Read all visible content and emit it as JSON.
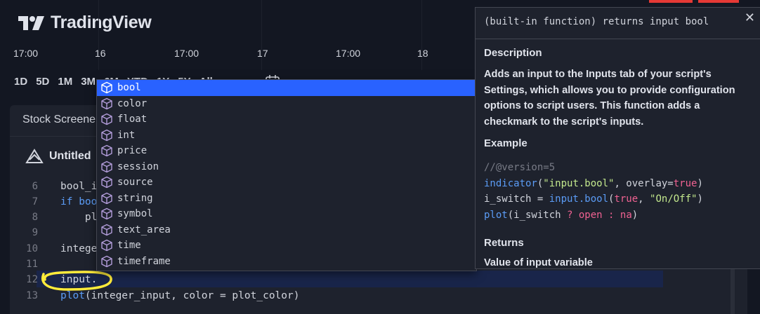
{
  "app": {
    "logo_text": "TradingView"
  },
  "time_axis": [
    "17:00",
    "16",
    "17:00",
    "17",
    "17:00",
    "18"
  ],
  "ranges": [
    "1D",
    "5D",
    "1M",
    "3M",
    "6M",
    "YTD",
    "1Y",
    "5Y",
    "All"
  ],
  "panel": {
    "tab_label": "Stock Screene",
    "script_name": "Untitled"
  },
  "editor": {
    "lines": [
      {
        "num": "6",
        "text": "bool_i"
      },
      {
        "num": "7",
        "text": "if boo"
      },
      {
        "num": "8",
        "text": "    pl"
      },
      {
        "num": "9",
        "text": ""
      },
      {
        "num": "10",
        "text": "intege"
      },
      {
        "num": "11",
        "text": ""
      },
      {
        "num": "12",
        "text": "input."
      },
      {
        "num": "13",
        "text_fn": "plot",
        "text_rest": "(integer_input, color = plot_color)"
      }
    ]
  },
  "autocomplete": {
    "items": [
      "bool",
      "color",
      "float",
      "int",
      "price",
      "session",
      "source",
      "string",
      "symbol",
      "text_area",
      "time",
      "timeframe"
    ],
    "selected_index": 0
  },
  "docs": {
    "signature": "(built-in function) returns input bool",
    "description_heading": "Description",
    "description": "Adds an input to the Inputs tab of your script's Settings, which allows you to provide configuration options to script users. This function adds a checkmark to the script's inputs.",
    "example_heading": "Example",
    "example": {
      "line1": "//@version=5",
      "line2_fn": "indicator",
      "line2_str": "\"input.bool\"",
      "line2_rest": ", overlay=",
      "line2_bool": "true",
      "line3_var": "i_switch = ",
      "line3_fn": "input.bool",
      "line3_bool": "true",
      "line3_str": "\"On/Off\"",
      "line4_fn": "plot",
      "line4_a": "(i_switch ",
      "line4_q": "?",
      "line4_open": " open ",
      "line4_c": ":",
      "line4_na": " na"
    },
    "returns_heading": "Returns",
    "returns_text": "Value of input variable"
  },
  "colors": {
    "accent": "#2962ff",
    "background": "#131722",
    "panel": "#1e222d",
    "annotation": "#ffeb3b"
  }
}
